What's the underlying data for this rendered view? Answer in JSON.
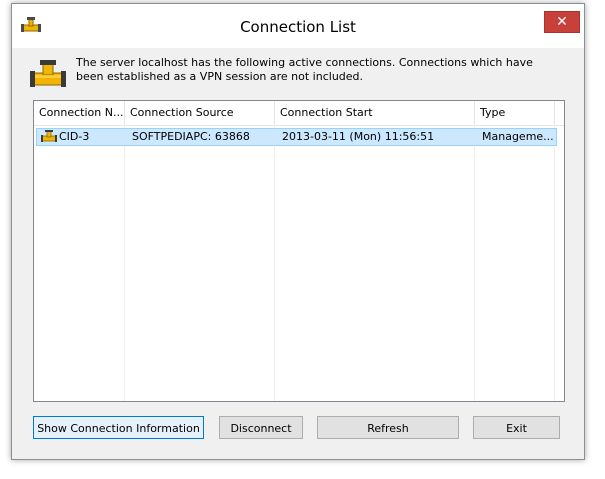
{
  "window": {
    "title": "Connection List",
    "close_glyph": "✕"
  },
  "message": "The server localhost has the following active connections. Connections which have been established as a VPN session are not included.",
  "table": {
    "columns": [
      "Connection N...",
      "Connection Source",
      "Connection Start",
      "Type"
    ],
    "rows": [
      {
        "name": "CID-3",
        "source": "SOFTPEDIAPC: 63868",
        "start": "2013-03-11 (Mon) 11:56:51",
        "type": "Manageme...",
        "icon": "pipe-connection-icon",
        "selected": true
      }
    ]
  },
  "buttons": {
    "show_info": "Show Connection Information",
    "disconnect": "Disconnect",
    "refresh": "Refresh",
    "exit": "Exit"
  },
  "colors": {
    "selection": "#cce8ff",
    "close": "#c7403a",
    "pipe_yellow": "#f2b400"
  }
}
